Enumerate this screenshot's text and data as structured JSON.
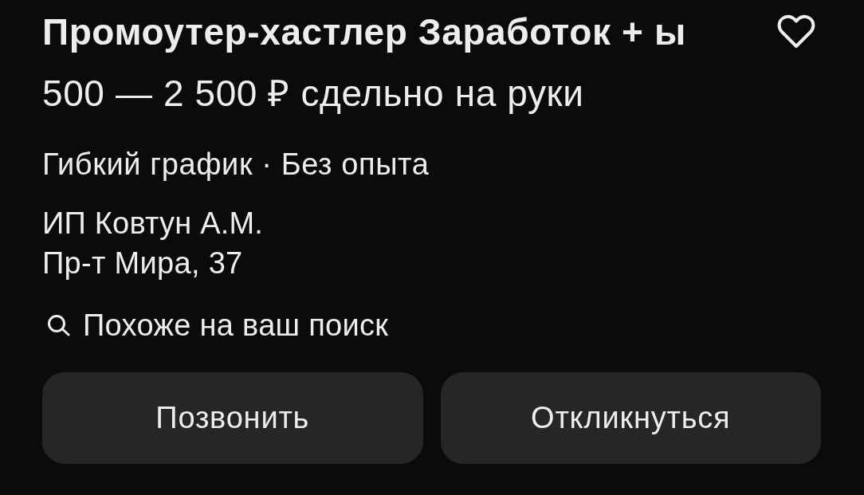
{
  "vacancy": {
    "title": "Промоутер-хастлер Заработок + ы",
    "favorite": false,
    "salary": "500 — 2 500 ₽ сдельно на руки",
    "conditions": "Гибкий график · Без опыта",
    "employer": "ИП Ковтун А.М.",
    "address": "Пр-т Мира, 37",
    "match_note": "Похоже на ваш поиск"
  },
  "buttons": [
    {
      "label": "Позвонить"
    },
    {
      "label": "Откликнуться"
    }
  ]
}
